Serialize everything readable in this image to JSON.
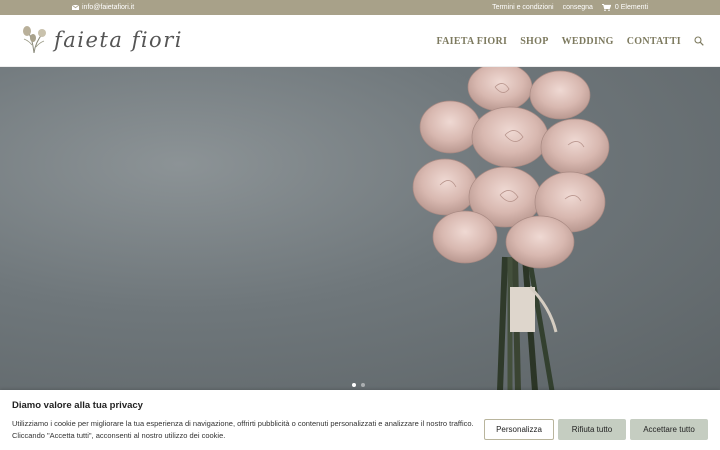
{
  "topbar": {
    "email": "info@faietafiori.it",
    "links": [
      "Termini e condizioni",
      "consegna"
    ],
    "cart": "0 Elementi"
  },
  "header": {
    "logo_text": "faieta fiori",
    "nav": [
      "FAIETA FIORI",
      "SHOP",
      "WEDDING",
      "CONTATTI"
    ]
  },
  "hero": {
    "slides_total": 2,
    "active_slide": 1
  },
  "cookie_banner": {
    "title": "Diamo valore alla tua privacy",
    "text": "Utilizziamo i cookie per migliorare la tua esperienza di navigazione, offrirti pubblicità o contenuti personalizzati e analizzare il nostro traffico. Cliccando \"Accetta tutti\", acconsenti al nostro utilizzo dei cookie.",
    "buttons": {
      "customize": "Personalizza",
      "reject": "Rifiuta tutto",
      "accept": "Accettare tutto"
    }
  },
  "colors": {
    "topbar_bg": "#a8a189",
    "nav_text": "#7d7a5f",
    "button_bg": "#c5cdc1"
  }
}
